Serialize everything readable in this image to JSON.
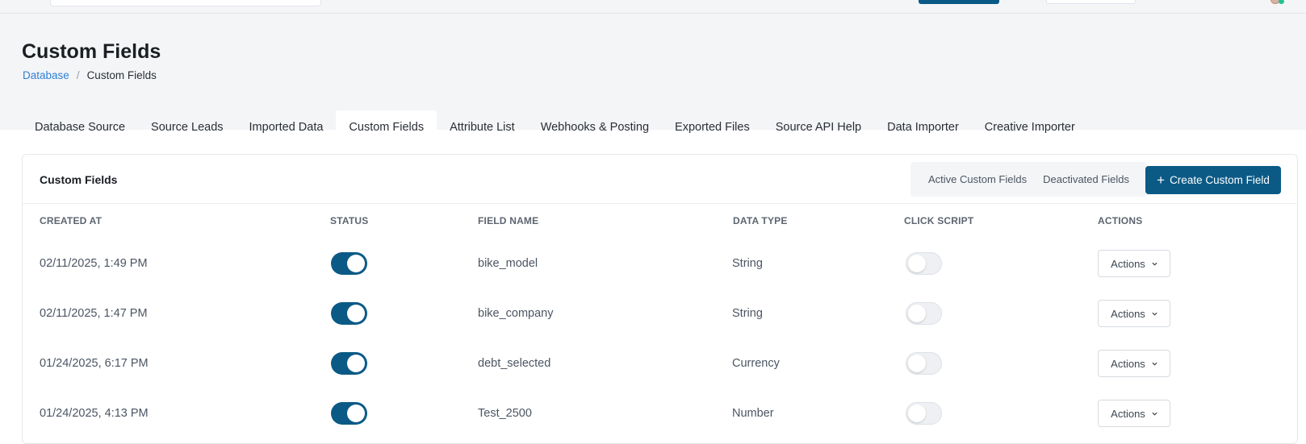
{
  "page": {
    "title": "Custom Fields"
  },
  "breadcrumb": {
    "parent": "Database",
    "separator": "/",
    "current": "Custom Fields"
  },
  "tabs": [
    {
      "label": "Database Source"
    },
    {
      "label": "Source Leads"
    },
    {
      "label": "Imported Data"
    },
    {
      "label": "Custom Fields",
      "active": true
    },
    {
      "label": "Attribute List"
    },
    {
      "label": "Webhooks & Posting"
    },
    {
      "label": "Exported Files"
    },
    {
      "label": "Source API Help"
    },
    {
      "label": "Data Importer"
    },
    {
      "label": "Creative Importer"
    }
  ],
  "card": {
    "title": "Custom Fields",
    "filters": {
      "active_label": "Active Custom Fields",
      "deactivated_label": "Deactivated Fields"
    },
    "create_button": {
      "icon": "plus-icon",
      "label": "Create Custom Field"
    }
  },
  "table": {
    "columns": [
      "CREATED AT",
      "STATUS",
      "FIELD NAME",
      "DATA TYPE",
      "CLICK SCRIPT",
      "ACTIONS"
    ],
    "rows": [
      {
        "created_at": "02/11/2025, 1:49 PM",
        "status": true,
        "field_name": "bike_model",
        "data_type": "String",
        "click_script": false,
        "action_label": "Actions"
      },
      {
        "created_at": "02/11/2025, 1:47 PM",
        "status": true,
        "field_name": "bike_company",
        "data_type": "String",
        "click_script": false,
        "action_label": "Actions"
      },
      {
        "created_at": "01/24/2025, 6:17 PM",
        "status": true,
        "field_name": "debt_selected",
        "data_type": "Currency",
        "click_script": false,
        "action_label": "Actions"
      },
      {
        "created_at": "01/24/2025, 4:13 PM",
        "status": true,
        "field_name": "Test_2500",
        "data_type": "Number",
        "click_script": false,
        "action_label": "Actions"
      }
    ]
  },
  "colors": {
    "primary": "#0b5a86",
    "link": "#2f7fd6",
    "header_bg": "#f4f5f7",
    "online_status": "#22c28e"
  }
}
